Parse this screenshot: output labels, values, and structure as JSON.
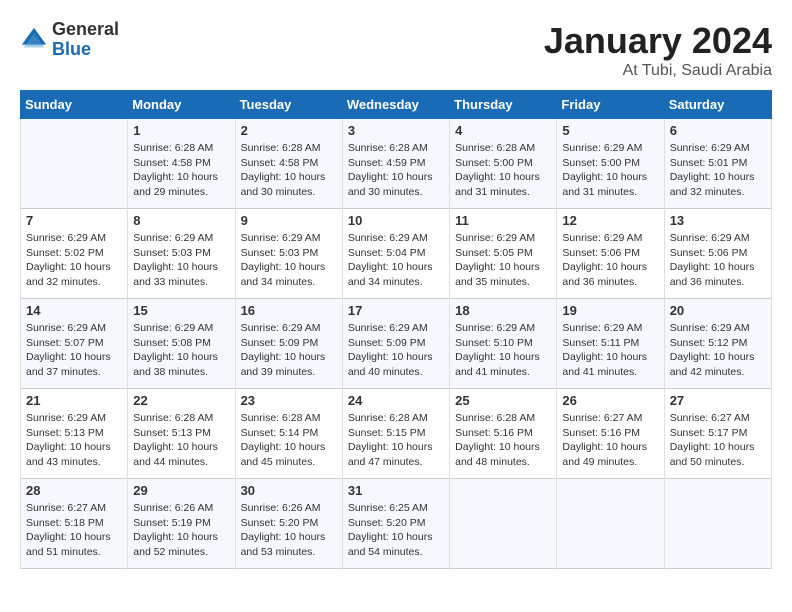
{
  "header": {
    "logo_general": "General",
    "logo_blue": "Blue",
    "month_title": "January 2024",
    "location": "At Tubi, Saudi Arabia"
  },
  "days_of_week": [
    "Sunday",
    "Monday",
    "Tuesday",
    "Wednesday",
    "Thursday",
    "Friday",
    "Saturday"
  ],
  "weeks": [
    [
      {
        "day": "",
        "sunrise": "",
        "sunset": "",
        "daylight": ""
      },
      {
        "day": "1",
        "sunrise": "Sunrise: 6:28 AM",
        "sunset": "Sunset: 4:58 PM",
        "daylight": "Daylight: 10 hours and 29 minutes."
      },
      {
        "day": "2",
        "sunrise": "Sunrise: 6:28 AM",
        "sunset": "Sunset: 4:58 PM",
        "daylight": "Daylight: 10 hours and 30 minutes."
      },
      {
        "day": "3",
        "sunrise": "Sunrise: 6:28 AM",
        "sunset": "Sunset: 4:59 PM",
        "daylight": "Daylight: 10 hours and 30 minutes."
      },
      {
        "day": "4",
        "sunrise": "Sunrise: 6:28 AM",
        "sunset": "Sunset: 5:00 PM",
        "daylight": "Daylight: 10 hours and 31 minutes."
      },
      {
        "day": "5",
        "sunrise": "Sunrise: 6:29 AM",
        "sunset": "Sunset: 5:00 PM",
        "daylight": "Daylight: 10 hours and 31 minutes."
      },
      {
        "day": "6",
        "sunrise": "Sunrise: 6:29 AM",
        "sunset": "Sunset: 5:01 PM",
        "daylight": "Daylight: 10 hours and 32 minutes."
      }
    ],
    [
      {
        "day": "7",
        "sunrise": "Sunrise: 6:29 AM",
        "sunset": "Sunset: 5:02 PM",
        "daylight": "Daylight: 10 hours and 32 minutes."
      },
      {
        "day": "8",
        "sunrise": "Sunrise: 6:29 AM",
        "sunset": "Sunset: 5:03 PM",
        "daylight": "Daylight: 10 hours and 33 minutes."
      },
      {
        "day": "9",
        "sunrise": "Sunrise: 6:29 AM",
        "sunset": "Sunset: 5:03 PM",
        "daylight": "Daylight: 10 hours and 34 minutes."
      },
      {
        "day": "10",
        "sunrise": "Sunrise: 6:29 AM",
        "sunset": "Sunset: 5:04 PM",
        "daylight": "Daylight: 10 hours and 34 minutes."
      },
      {
        "day": "11",
        "sunrise": "Sunrise: 6:29 AM",
        "sunset": "Sunset: 5:05 PM",
        "daylight": "Daylight: 10 hours and 35 minutes."
      },
      {
        "day": "12",
        "sunrise": "Sunrise: 6:29 AM",
        "sunset": "Sunset: 5:06 PM",
        "daylight": "Daylight: 10 hours and 36 minutes."
      },
      {
        "day": "13",
        "sunrise": "Sunrise: 6:29 AM",
        "sunset": "Sunset: 5:06 PM",
        "daylight": "Daylight: 10 hours and 36 minutes."
      }
    ],
    [
      {
        "day": "14",
        "sunrise": "Sunrise: 6:29 AM",
        "sunset": "Sunset: 5:07 PM",
        "daylight": "Daylight: 10 hours and 37 minutes."
      },
      {
        "day": "15",
        "sunrise": "Sunrise: 6:29 AM",
        "sunset": "Sunset: 5:08 PM",
        "daylight": "Daylight: 10 hours and 38 minutes."
      },
      {
        "day": "16",
        "sunrise": "Sunrise: 6:29 AM",
        "sunset": "Sunset: 5:09 PM",
        "daylight": "Daylight: 10 hours and 39 minutes."
      },
      {
        "day": "17",
        "sunrise": "Sunrise: 6:29 AM",
        "sunset": "Sunset: 5:09 PM",
        "daylight": "Daylight: 10 hours and 40 minutes."
      },
      {
        "day": "18",
        "sunrise": "Sunrise: 6:29 AM",
        "sunset": "Sunset: 5:10 PM",
        "daylight": "Daylight: 10 hours and 41 minutes."
      },
      {
        "day": "19",
        "sunrise": "Sunrise: 6:29 AM",
        "sunset": "Sunset: 5:11 PM",
        "daylight": "Daylight: 10 hours and 41 minutes."
      },
      {
        "day": "20",
        "sunrise": "Sunrise: 6:29 AM",
        "sunset": "Sunset: 5:12 PM",
        "daylight": "Daylight: 10 hours and 42 minutes."
      }
    ],
    [
      {
        "day": "21",
        "sunrise": "Sunrise: 6:29 AM",
        "sunset": "Sunset: 5:13 PM",
        "daylight": "Daylight: 10 hours and 43 minutes."
      },
      {
        "day": "22",
        "sunrise": "Sunrise: 6:28 AM",
        "sunset": "Sunset: 5:13 PM",
        "daylight": "Daylight: 10 hours and 44 minutes."
      },
      {
        "day": "23",
        "sunrise": "Sunrise: 6:28 AM",
        "sunset": "Sunset: 5:14 PM",
        "daylight": "Daylight: 10 hours and 45 minutes."
      },
      {
        "day": "24",
        "sunrise": "Sunrise: 6:28 AM",
        "sunset": "Sunset: 5:15 PM",
        "daylight": "Daylight: 10 hours and 47 minutes."
      },
      {
        "day": "25",
        "sunrise": "Sunrise: 6:28 AM",
        "sunset": "Sunset: 5:16 PM",
        "daylight": "Daylight: 10 hours and 48 minutes."
      },
      {
        "day": "26",
        "sunrise": "Sunrise: 6:27 AM",
        "sunset": "Sunset: 5:16 PM",
        "daylight": "Daylight: 10 hours and 49 minutes."
      },
      {
        "day": "27",
        "sunrise": "Sunrise: 6:27 AM",
        "sunset": "Sunset: 5:17 PM",
        "daylight": "Daylight: 10 hours and 50 minutes."
      }
    ],
    [
      {
        "day": "28",
        "sunrise": "Sunrise: 6:27 AM",
        "sunset": "Sunset: 5:18 PM",
        "daylight": "Daylight: 10 hours and 51 minutes."
      },
      {
        "day": "29",
        "sunrise": "Sunrise: 6:26 AM",
        "sunset": "Sunset: 5:19 PM",
        "daylight": "Daylight: 10 hours and 52 minutes."
      },
      {
        "day": "30",
        "sunrise": "Sunrise: 6:26 AM",
        "sunset": "Sunset: 5:20 PM",
        "daylight": "Daylight: 10 hours and 53 minutes."
      },
      {
        "day": "31",
        "sunrise": "Sunrise: 6:25 AM",
        "sunset": "Sunset: 5:20 PM",
        "daylight": "Daylight: 10 hours and 54 minutes."
      },
      {
        "day": "",
        "sunrise": "",
        "sunset": "",
        "daylight": ""
      },
      {
        "day": "",
        "sunrise": "",
        "sunset": "",
        "daylight": ""
      },
      {
        "day": "",
        "sunrise": "",
        "sunset": "",
        "daylight": ""
      }
    ]
  ]
}
